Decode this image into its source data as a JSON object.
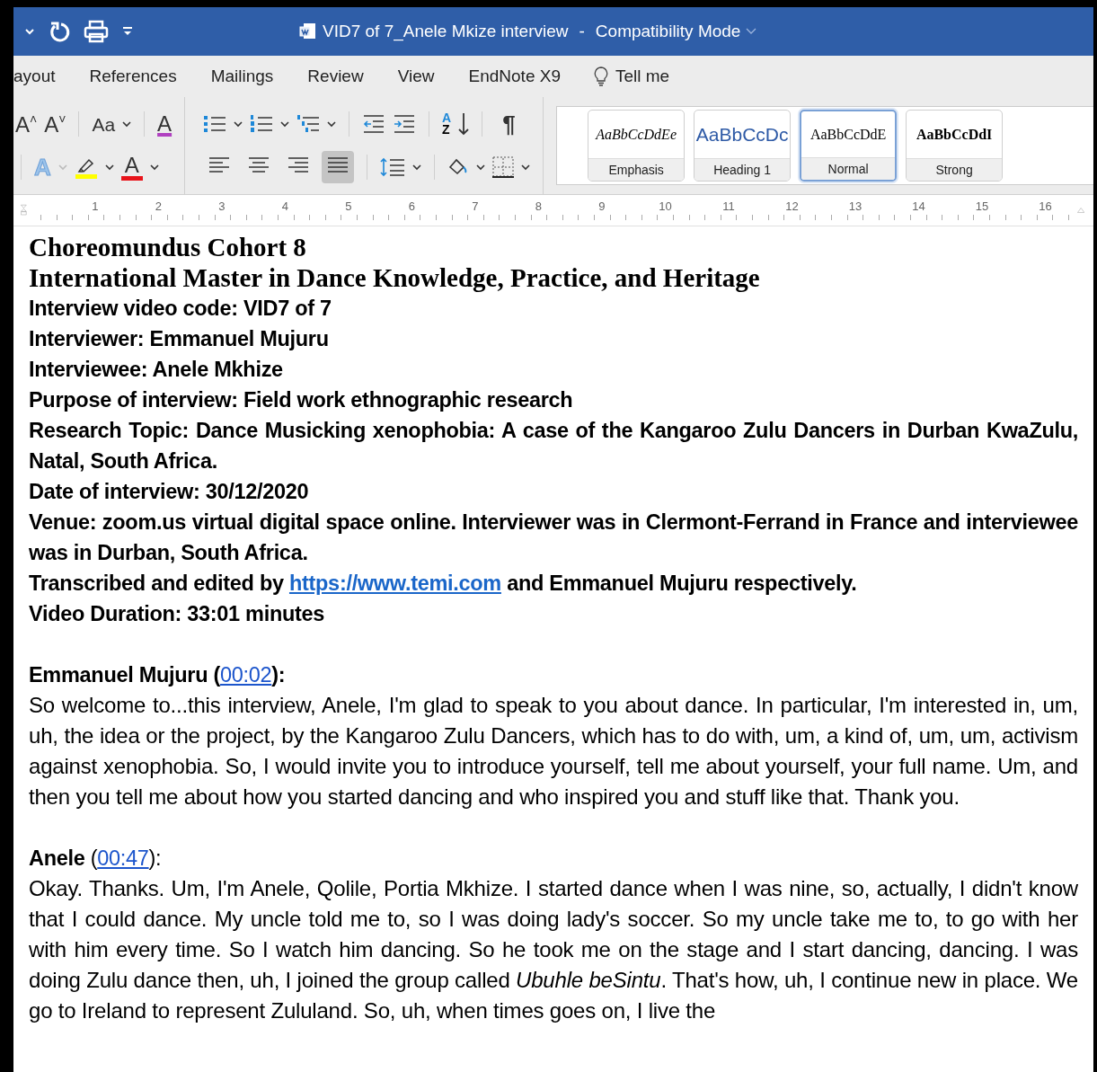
{
  "title_bar": {
    "title": "VID7 of 7_Anele Mkize interview",
    "separator": "-",
    "mode": "Compatibility Mode"
  },
  "menu_tabs": [
    "ayout",
    "References",
    "Mailings",
    "Review",
    "View",
    "EndNote X9"
  ],
  "tell_me": "Tell me",
  "ribbon": {
    "grow_font": "A",
    "grow_mark": "˄",
    "shrink_font": "A",
    "shrink_mark": "˅",
    "change_case": "Aa",
    "clear_formatting": "A",
    "text_effects": "A",
    "font_color": "A",
    "sort_top": "A",
    "sort_bottom": "Z",
    "pilcrow": "¶",
    "alignment_buttons": [
      {
        "selected": false
      },
      {
        "selected": false
      },
      {
        "selected": false
      },
      {
        "selected": true
      }
    ]
  },
  "styles": [
    {
      "kind": "emphasis",
      "sample": "AaBbCcDdEe",
      "label": "Emphasis",
      "selected": false
    },
    {
      "kind": "heading",
      "sample": "AaBbCcDc",
      "label": "Heading 1",
      "selected": false
    },
    {
      "kind": "normal",
      "sample": "AaBbCcDdE",
      "label": "Normal",
      "selected": true
    },
    {
      "kind": "strong",
      "sample": "AaBbCcDdI",
      "label": "Strong",
      "selected": false
    }
  ],
  "ruler": [
    "1",
    "2",
    "3",
    "4",
    "5",
    "6",
    "7",
    "8",
    "9",
    "10",
    "11",
    "12",
    "13",
    "14",
    "15",
    "16"
  ],
  "document": {
    "header": [
      {
        "kind": "title",
        "runs": [
          {
            "text": "Choreomundus Cohort 8"
          }
        ]
      },
      {
        "kind": "title",
        "runs": [
          {
            "text": "International Master in Dance Knowledge, Practice, and Heritage"
          }
        ]
      },
      {
        "kind": "field",
        "runs": [
          {
            "text": "Interview video code: VID7 of 7"
          }
        ]
      },
      {
        "kind": "field",
        "runs": [
          {
            "text": "Interviewer: Emmanuel Mujuru"
          }
        ]
      },
      {
        "kind": "field",
        "runs": [
          {
            "text": "Interviewee: Anele Mkhize"
          }
        ]
      },
      {
        "kind": "field",
        "runs": [
          {
            "text": "Purpose of interview: Field work ethnographic research"
          }
        ]
      },
      {
        "kind": "field",
        "runs": [
          {
            "text": "Research Topic: Dance Musicking xenophobia: A case of the Kangaroo Zulu Dancers in Durban KwaZulu, Natal, South Africa."
          }
        ]
      },
      {
        "kind": "field",
        "runs": [
          {
            "text": "Date of interview: 30/12/2020"
          }
        ]
      },
      {
        "kind": "field",
        "runs": [
          {
            "text": "Venue: zoom.us virtual digital space online. Interviewer was in Clermont-Ferrand in France and interviewee was in Durban, South Africa."
          }
        ]
      },
      {
        "kind": "field",
        "runs": [
          {
            "text": "Transcribed and edited by "
          },
          {
            "text": "https://www.temi.com",
            "link": true
          },
          {
            "text": " and Emmanuel Mujuru respectively."
          }
        ]
      },
      {
        "kind": "field",
        "runs": [
          {
            "text": "Video Duration:  33:01 minutes"
          }
        ]
      }
    ],
    "turns": [
      {
        "speaker": [
          {
            "text": "Emmanuel Mujuru (",
            "bold": true
          },
          {
            "text": "00:02",
            "link": true
          },
          {
            "text": "):",
            "bold": true
          }
        ],
        "text": "So welcome to...this interview, Anele, I'm glad to speak to you about dance. In particular, I'm interested in, um, uh, the idea or the project, by the Kangaroo Zulu Dancers, which has to do with, um, a kind of, um, um, activism against xenophobia. So, I would invite you to introduce yourself, tell me about yourself, your full name. Um, and then you tell me about how you started dancing and who inspired you and stuff like that. Thank you."
      },
      {
        "speaker": [
          {
            "text": "Anele ",
            "bold": true
          },
          {
            "text": "(",
            "bold": false
          },
          {
            "text": "00:47",
            "link": true
          },
          {
            "text": "):",
            "bold": false
          }
        ],
        "text": "Okay. Thanks. Um, I'm Anele, Qolile, Portia Mkhize. I started dance when I was nine, so, actually, I didn't know that I could dance. My uncle told me to, so I was doing lady's soccer. So my uncle take me to, to go with her with him every time. So I watch him dancing. So he took me on the stage and I start dancing, dancing. I was doing Zulu dance then, uh, I joined the group called *Ubuhle beSintu*. That's how, uh, I continue new in place. We go to Ireland to represent Zululand. So, uh, when times goes on, I live the"
      }
    ]
  }
}
